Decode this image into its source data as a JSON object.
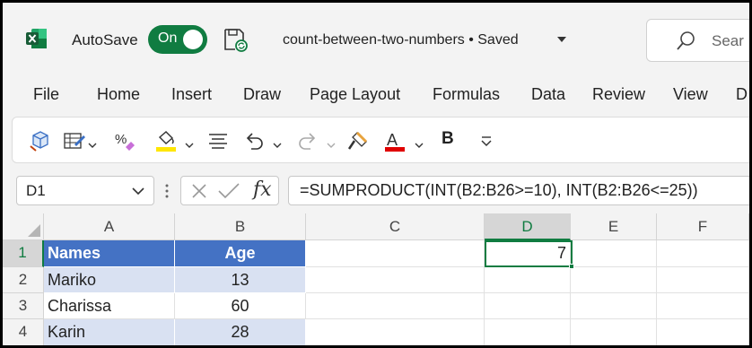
{
  "app": {
    "autosave_label": "AutoSave",
    "autosave_state": "On",
    "doc_title": "count-between-two-numbers • Saved",
    "search_text": "Sear",
    "brand_color": "#107c41"
  },
  "menu": {
    "items": [
      "File",
      "Home",
      "Insert",
      "Draw",
      "Page Layout",
      "Formulas",
      "Data",
      "Review",
      "View",
      "D"
    ]
  },
  "ribbon": {
    "icons": [
      "format-3d-icon",
      "form-table-icon",
      "percent-clear-icon",
      "fill-color-icon",
      "align-icon",
      "undo-icon",
      "redo-icon",
      "format-painter-icon",
      "font-color-icon",
      "bold-icon",
      "more-commands-icon"
    ],
    "bold_label": "B",
    "font_color_letter": "A",
    "font_color": "#e00000",
    "fill_color": "#ffe600"
  },
  "formula_bar": {
    "name_box": "D1",
    "fx_label": "fx",
    "formula": "=SUMPRODUCT(INT(B2:B26>=10), INT(B2:B26<=25))"
  },
  "sheet": {
    "columns": [
      "A",
      "B",
      "C",
      "D",
      "E",
      "F"
    ],
    "rows": [
      "1",
      "2",
      "3",
      "4"
    ],
    "selected_cell": "D1",
    "header": {
      "name": "Names",
      "age": "Age"
    },
    "data": [
      {
        "name": "Mariko",
        "age": "13"
      },
      {
        "name": "Charissa",
        "age": "60"
      },
      {
        "name": "Karin",
        "age": "28"
      }
    ],
    "d1_value": "7",
    "header_fill": "#4472c4",
    "band_fill": "#d9e1f2"
  }
}
